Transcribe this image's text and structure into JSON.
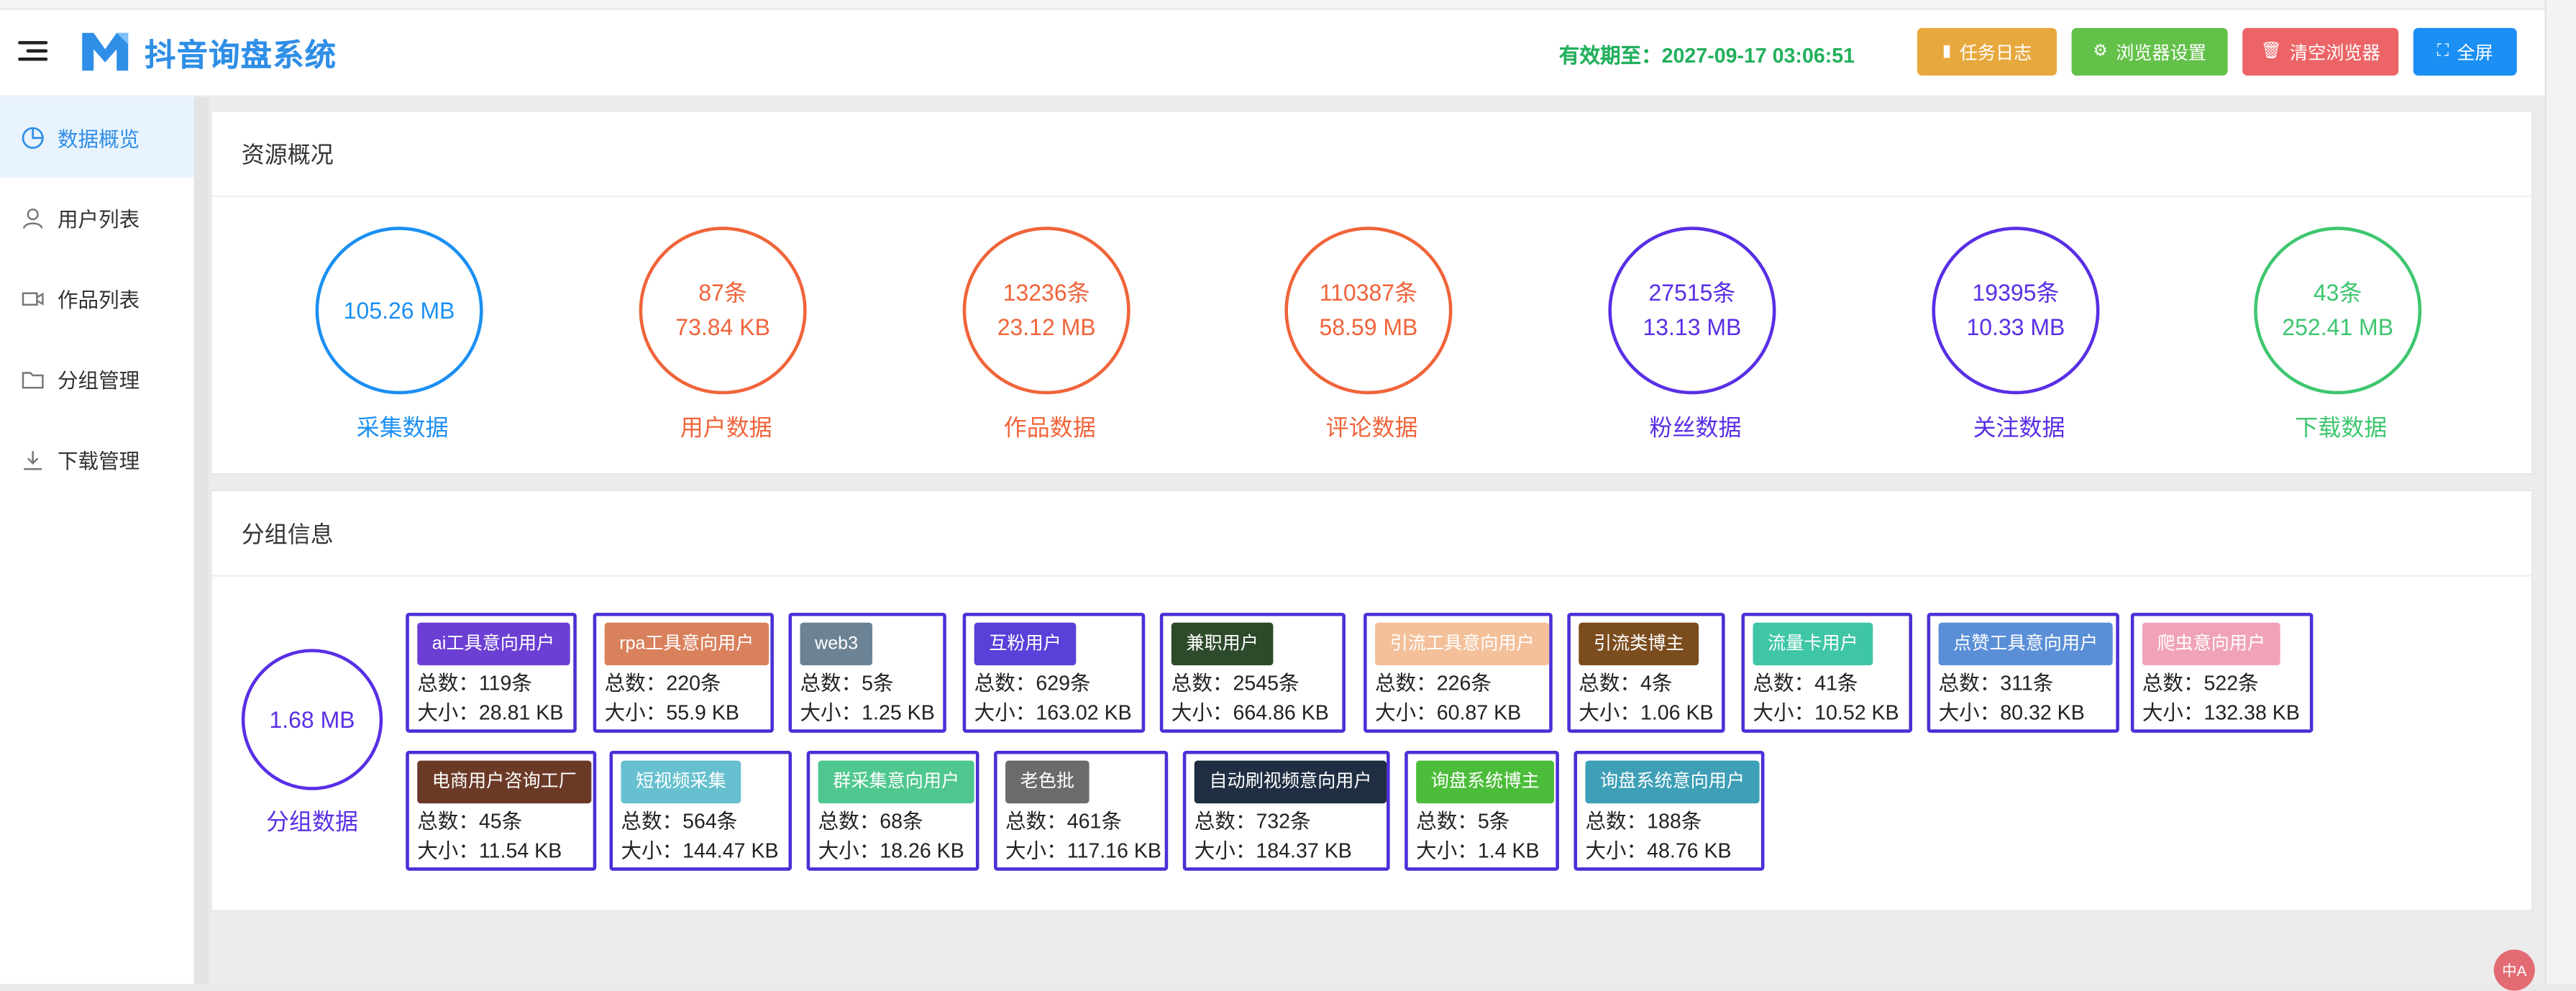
{
  "header": {
    "app_title": "抖音询盘系统",
    "expiry": "有效期至：2027-09-17 03:06:51",
    "buttons": {
      "task_log": "任务日志",
      "browser_settings": "浏览器设置",
      "clear_browser": "清空浏览器",
      "fullscreen": "全屏"
    },
    "colors": {
      "brand": "#2f8ee6",
      "expiry": "#22b05c",
      "task_log": "#e7a83d",
      "browser_settings": "#63c14a",
      "clear_browser": "#ec6466",
      "fullscreen": "#1b8ff3"
    }
  },
  "sidebar": {
    "items": [
      {
        "label": "数据概览",
        "icon": "pie-chart-icon",
        "active": true
      },
      {
        "label": "用户列表",
        "icon": "user-icon",
        "active": false
      },
      {
        "label": "作品列表",
        "icon": "video-icon",
        "active": false
      },
      {
        "label": "分组管理",
        "icon": "folder-icon",
        "active": false
      },
      {
        "label": "下载管理",
        "icon": "download-icon",
        "active": false
      }
    ]
  },
  "resources": {
    "title": "资源概况",
    "items": [
      {
        "lines": [
          "105.26 MB"
        ],
        "label": "采集数据",
        "color": "#1b8ff3"
      },
      {
        "lines": [
          "87条",
          "73.84 KB"
        ],
        "label": "用户数据",
        "color": "#f0643a"
      },
      {
        "lines": [
          "13236条",
          "23.12 MB"
        ],
        "label": "作品数据",
        "color": "#f0643a"
      },
      {
        "lines": [
          "110387条",
          "58.59 MB"
        ],
        "label": "评论数据",
        "color": "#f0643a"
      },
      {
        "lines": [
          "27515条",
          "13.13 MB"
        ],
        "label": "粉丝数据",
        "color": "#5a2ee5"
      },
      {
        "lines": [
          "19395条",
          "10.33 MB"
        ],
        "label": "关注数据",
        "color": "#5a2ee5"
      },
      {
        "lines": [
          "43条",
          "252.41 MB"
        ],
        "label": "下载数据",
        "color": "#3ec66f"
      }
    ]
  },
  "groups": {
    "title": "分组信息",
    "total_size": "1.68 MB",
    "total_label": "分组数据",
    "items": [
      {
        "name": "ai工具意向用户",
        "count": "总数：119条",
        "size": "大小：28.81 KB",
        "color": "#6b3fd4"
      },
      {
        "name": "rpa工具意向用户",
        "count": "总数：220条",
        "size": "大小：55.9 KB",
        "color": "#d9805c"
      },
      {
        "name": "web3",
        "count": "总数：5条",
        "size": "大小：1.25 KB",
        "color": "#6c8395"
      },
      {
        "name": "互粉用户",
        "count": "总数：629条",
        "size": "大小：163.02 KB",
        "color": "#5a3fd8"
      },
      {
        "name": "兼职用户",
        "count": "总数：2545条",
        "size": "大小：664.86 KB",
        "color": "#2d4a2a"
      },
      {
        "name": "引流工具意向用户",
        "count": "总数：226条",
        "size": "大小：60.87 KB",
        "color": "#f3c09a"
      },
      {
        "name": "引流类博主",
        "count": "总数：4条",
        "size": "大小：1.06 KB",
        "color": "#7b4c1e"
      },
      {
        "name": "流量卡用户",
        "count": "总数：41条",
        "size": "大小：10.52 KB",
        "color": "#3fc6a6"
      },
      {
        "name": "点赞工具意向用户",
        "count": "总数：311条",
        "size": "大小：80.32 KB",
        "color": "#5a8fd8"
      },
      {
        "name": "爬虫意向用户",
        "count": "总数：522条",
        "size": "大小：132.38 KB",
        "color": "#f0a3b8"
      },
      {
        "name": "电商用户咨询工厂",
        "count": "总数：45条",
        "size": "大小：11.54 KB",
        "color": "#6b3a26"
      },
      {
        "name": "短视频采集",
        "count": "总数：564条",
        "size": "大小：144.47 KB",
        "color": "#66c0cf"
      },
      {
        "name": "群采集意向用户",
        "count": "总数：68条",
        "size": "大小：18.26 KB",
        "color": "#4fc78f"
      },
      {
        "name": "老色批",
        "count": "总数：461条",
        "size": "大小：117.16 KB",
        "color": "#6b6b6b"
      },
      {
        "name": "自动刷视频意向用户",
        "count": "总数：732条",
        "size": "大小：184.37 KB",
        "color": "#1f2e42"
      },
      {
        "name": "询盘系统博主",
        "count": "总数：5条",
        "size": "大小：1.4 KB",
        "color": "#4cbd3a"
      },
      {
        "name": "询盘系统意向用户",
        "count": "总数：188条",
        "size": "大小：48.76 KB",
        "color": "#3e9fb6"
      }
    ]
  },
  "translate_badge": "中A"
}
